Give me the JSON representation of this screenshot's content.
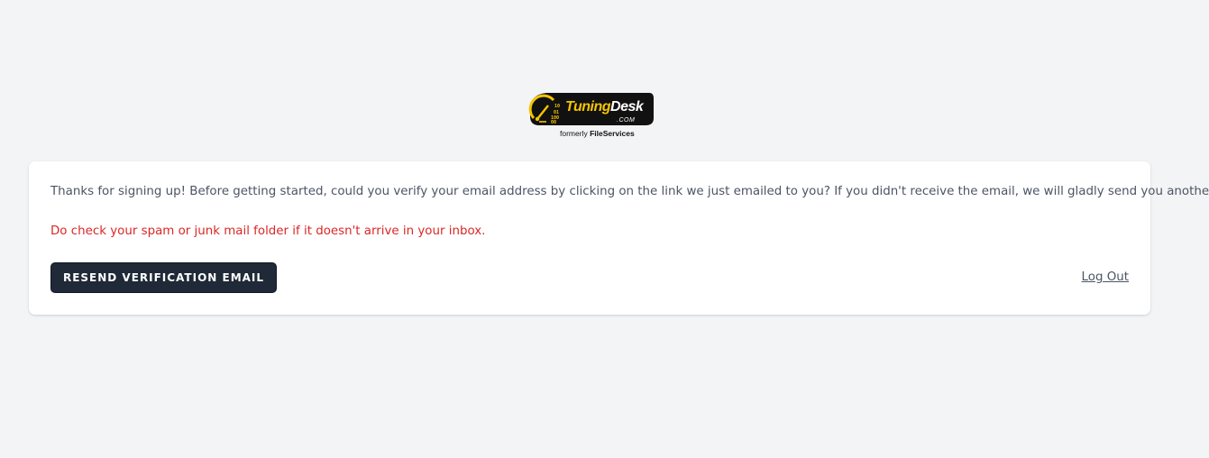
{
  "logo": {
    "brand_first": "Tuning",
    "brand_second": "Desk",
    "brand_suffix": ".COM",
    "tagline_prefix": "formerly",
    "tagline_name": "FileServices",
    "colors": {
      "badge": "#111111",
      "accent": "#f5c400"
    }
  },
  "card": {
    "message": "Thanks for signing up! Before getting started, could you verify your email address by clicking on the link we just emailed to you? If you didn't receive the email, we will gladly send you another.",
    "warning": "Do check your spam or junk mail folder if it doesn't arrive in your inbox.",
    "resend_label": "Resend Verification Email",
    "logout_label": "Log Out"
  },
  "colors": {
    "page_bg": "#f3f4f6",
    "card_bg": "#ffffff",
    "text": "#4b5563",
    "warning": "#dc2626",
    "button_bg": "#1f2937"
  }
}
